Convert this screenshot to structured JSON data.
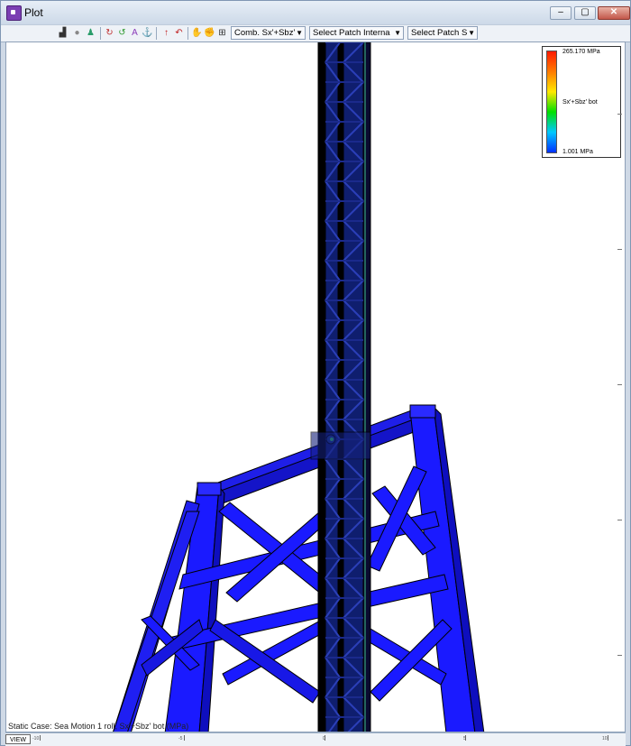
{
  "window": {
    "title": "Plot"
  },
  "titlebar_buttons": {
    "minimize": "–",
    "maximize": "▢",
    "close": "✕"
  },
  "toolbar": {
    "icons": [
      "view-plot-icon",
      "circle-icon",
      "person-icon",
      "rotate-icon",
      "rotate-alt-icon",
      "text-label-icon",
      "anchor-icon",
      "arrow-up-icon",
      "undo-icon",
      "hand-icon",
      "hand-grab-icon",
      "zoom-fit-icon"
    ],
    "combo_component": "Comb. Sx'+Sbz'",
    "combo_patch_interna": "Select Patch Interna",
    "combo_patch": "Select Patch S"
  },
  "legend": {
    "max_label": "265.170 MPa",
    "mid_label": "Sx'+Sbz' bot",
    "min_label": "1.001 MPa",
    "colors": [
      "#ff1a00",
      "#ffe800",
      "#00e000",
      "#00c8ff",
      "#0030ff"
    ]
  },
  "status": {
    "text": "Static Case: Sea Motion 1 roll, Sx'+Sbz' bot (MPa)"
  },
  "view_label": "VIEW",
  "axis_ticks": [
    "-10",
    "-5",
    "0",
    "5",
    "10"
  ],
  "structure_colors": {
    "member": "#1a1aff",
    "mast": "#0f1e6e",
    "edge": "#000000"
  }
}
